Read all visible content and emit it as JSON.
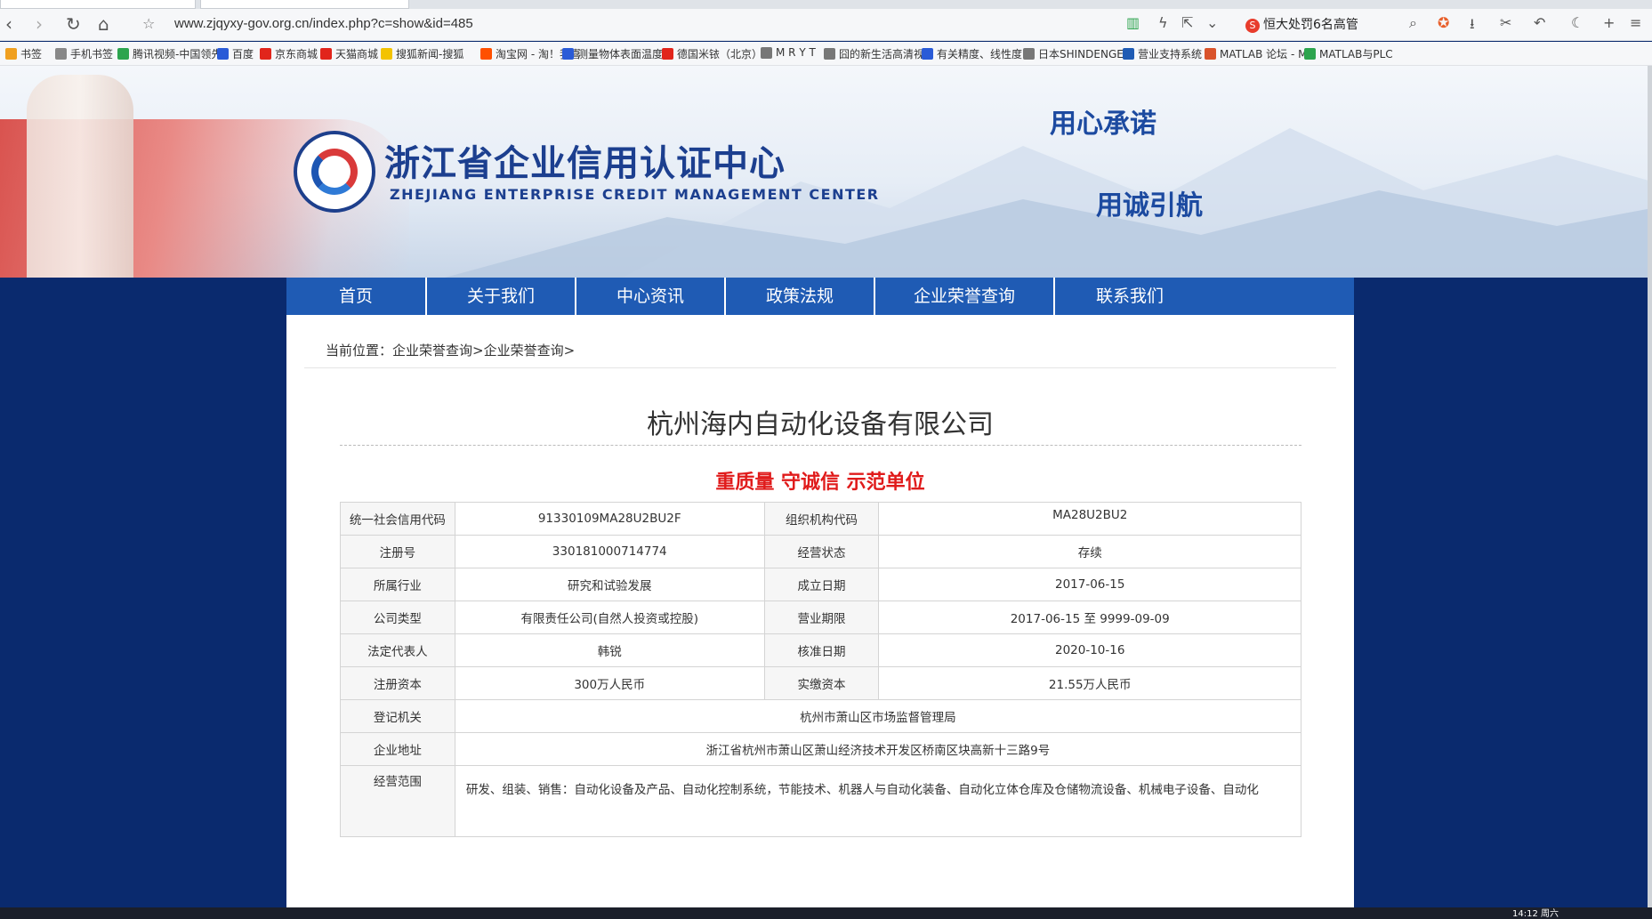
{
  "browser": {
    "url": "www.zjqyxy-gov.org.cn/index.php?c=show&id=485",
    "news_ticker": "恒大处罚6名高管",
    "bookmarks": [
      {
        "label": "书签",
        "color": "#f0a020",
        "icon": "star-icon"
      },
      {
        "label": "手机书签",
        "color": "#888888",
        "icon": "phone-icon"
      },
      {
        "label": "腾讯视频-中国领先",
        "color": "#2da44e",
        "icon": "video-icon"
      },
      {
        "label": "百度",
        "color": "#2a5bd7",
        "icon": "paw-icon"
      },
      {
        "label": "京东商城",
        "color": "#e1251b",
        "icon": "jd-icon"
      },
      {
        "label": "天猫商城",
        "color": "#e1251b",
        "icon": "tmall-icon"
      },
      {
        "label": "搜狐新闻-搜狐",
        "color": "#f3c300",
        "icon": "sohu-icon"
      },
      {
        "label": "淘宝网 - 淘！我喜",
        "color": "#ff5000",
        "icon": "taobao-icon"
      },
      {
        "label": "测量物体表面温度",
        "color": "#2a5bd7",
        "icon": "paw-icon"
      },
      {
        "label": "德国米铱（北京）",
        "color": "#e1251b",
        "icon": "micro-icon"
      },
      {
        "label": "M R Y T",
        "color": "#777777",
        "icon": "globe-icon"
      },
      {
        "label": "囧的新生活高清视",
        "color": "#777777",
        "icon": "face-icon"
      },
      {
        "label": "有关精度、线性度",
        "color": "#2a5bd7",
        "icon": "paw-icon"
      },
      {
        "label": "日本SHINDENGE",
        "color": "#777777",
        "icon": "globe-icon"
      },
      {
        "label": "营业支持系统",
        "color": "#1f5bb4",
        "icon": "system-icon"
      },
      {
        "label": "MATLAB 论坛 - M",
        "color": "#d9532b",
        "icon": "matlab-icon"
      },
      {
        "label": "MATLAB与PLC",
        "color": "#2da44e",
        "icon": "matlab-icon"
      }
    ]
  },
  "header": {
    "org_cn": "浙江省企业信用认证中心",
    "org_en": "ZHEJIANG ENTERPRISE CREDIT MANAGEMENT CENTER",
    "slogan1": "用心承诺",
    "slogan2": "用诚引航"
  },
  "nav": [
    "首页",
    "关于我们",
    "中心资讯",
    "政策法规",
    "企业荣誉查询",
    "联系我们"
  ],
  "breadcrumb": "当前位置：企业荣誉查询>企业荣誉查询>",
  "company": "杭州海内自动化设备有限公司",
  "award": "重质量 守诚信 示范单位",
  "table": {
    "rows": [
      [
        "统一社会信用代码",
        "91330109MA28U2BU2F",
        "组织机构代码",
        "MA28U2BU2"
      ],
      [
        "注册号",
        "330181000714774",
        "经营状态",
        "存续"
      ],
      [
        "所属行业",
        "研究和试验发展",
        "成立日期",
        "2017-06-15"
      ],
      [
        "公司类型",
        "有限责任公司(自然人投资或控股)",
        "营业期限",
        "2017-06-15 至 9999-09-09"
      ],
      [
        "法定代表人",
        "韩锐",
        "核准日期",
        "2020-10-16"
      ],
      [
        "注册资本",
        "300万人民币",
        "实缴资本",
        "21.55万人民币"
      ]
    ],
    "authority_label": "登记机关",
    "authority": "杭州市萧山区市场监督管理局",
    "address_label": "企业地址",
    "address": "浙江省杭州市萧山区萧山经济技术开发区桥南区块高新十三路9号",
    "scope_label": "经营范围",
    "scope": "研发、组装、销售：自动化设备及产品、自动化控制系统，节能技术、机器人与自动化装备、自动化立体仓库及仓储物流设备、机械电子设备、自动化"
  },
  "taskbar": {
    "clock": "14:12 周六"
  }
}
